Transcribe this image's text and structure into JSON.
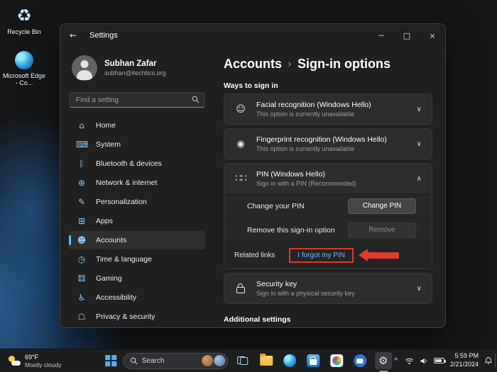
{
  "colors": {
    "accent": "#4cc2ff",
    "annotation_red": "#e23a2d",
    "link_blue": "#74b9ea",
    "window_bg": "#202020",
    "card_bg": "#2d2d2d"
  },
  "desktop": {
    "icons": [
      {
        "name": "recycle-bin",
        "label": "Recycle Bin",
        "glyph": "♻"
      },
      {
        "name": "microsoft-edge",
        "label": "Microsoft Edge - Co..."
      }
    ]
  },
  "window": {
    "titlebar": {
      "title": "Settings",
      "back_glyph": "←",
      "minimize_glyph": "─",
      "maximize_glyph": "□",
      "close_glyph": "×"
    },
    "profile": {
      "name": "Subhan Zafar",
      "email": "subhan@itechtics.org"
    },
    "search": {
      "placeholder": "Find a setting"
    },
    "nav": [
      {
        "label": "Home",
        "glyph": "⌂"
      },
      {
        "label": "System",
        "glyph": "⌨"
      },
      {
        "label": "Bluetooth & devices",
        "glyph": "ᛒ"
      },
      {
        "label": "Network & internet",
        "glyph": "⊕"
      },
      {
        "label": "Personalization",
        "glyph": "✎"
      },
      {
        "label": "Apps",
        "glyph": "⊞"
      },
      {
        "label": "Accounts",
        "glyph": "☻",
        "selected": true
      },
      {
        "label": "Time & language",
        "glyph": "◷"
      },
      {
        "label": "Gaming",
        "glyph": "⚄"
      },
      {
        "label": "Accessibility",
        "glyph": "♿"
      },
      {
        "label": "Privacy & security",
        "glyph": "☖"
      }
    ],
    "content": {
      "breadcrumb": {
        "parent": "Accounts",
        "separator": "›",
        "current": "Sign-in options"
      },
      "section_title": "Ways to sign in",
      "cards": [
        {
          "title": "Facial recognition (Windows Hello)",
          "subtitle": "This option is currently unavailable",
          "glyph": "☺",
          "chevron": "∨"
        },
        {
          "title": "Fingerprint recognition (Windows Hello)",
          "subtitle": "This option is currently unavailable",
          "glyph": "◉",
          "chevron": "∨"
        },
        {
          "title": "PIN (Windows Hello)",
          "subtitle": "Sign in with a PIN (Recommended)",
          "glyph": "∷∷",
          "chevron": "∧"
        },
        {
          "title": "Security key",
          "subtitle": "Sign in with a physical security key",
          "chevron": "∨"
        }
      ],
      "pin_panel": {
        "rows": [
          {
            "label": "Change your PIN",
            "button": "Change PIN"
          },
          {
            "label": "Remove this sign-in option",
            "button": "Remove"
          }
        ],
        "related_links_label": "Related links",
        "forgot_pin_link": "I forgot my PIN"
      },
      "additional_settings_title": "Additional settings"
    }
  },
  "taskbar": {
    "weather": {
      "temp": "69°F",
      "condition": "Mostly cloudy"
    },
    "search_label": "Search",
    "settings_gear_glyph": "⚙",
    "tray": {
      "chevron": "^",
      "time": "5:59 PM",
      "date": "2/21/2024"
    }
  }
}
